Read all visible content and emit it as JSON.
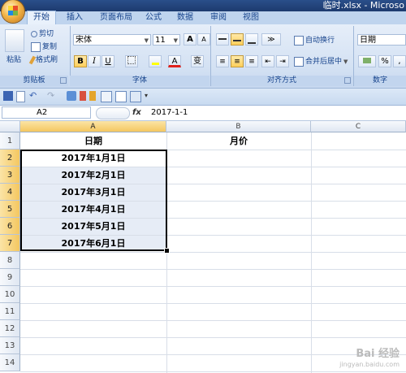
{
  "window": {
    "title": "临时.xlsx - Microso"
  },
  "tabs": [
    {
      "label": "开始",
      "active": true
    },
    {
      "label": "插入"
    },
    {
      "label": "页面布局"
    },
    {
      "label": "公式"
    },
    {
      "label": "数据"
    },
    {
      "label": "审阅"
    },
    {
      "label": "视图"
    }
  ],
  "ribbon": {
    "clipboard": {
      "paste": "粘贴",
      "cut": "剪切",
      "copy": "复制",
      "format_painter": "格式刷",
      "label": "剪贴板"
    },
    "font": {
      "name": "宋体",
      "size": "11",
      "bold": "B",
      "italic": "I",
      "underline": "U",
      "grow": "A",
      "shrink": "A",
      "font_color": "A",
      "phonetic": "变",
      "label": "字体"
    },
    "alignment": {
      "wrap": "自动换行",
      "merge": "合并后居中",
      "label": "对齐方式"
    },
    "number": {
      "format": "日期",
      "percent": "%",
      "comma": ",",
      "label": "数字"
    }
  },
  "formula_bar": {
    "name_box": "A2",
    "fx": "fx",
    "content": "2017-1-1"
  },
  "columns": [
    "A",
    "B",
    "C"
  ],
  "rows": [
    "1",
    "2",
    "3",
    "4",
    "5",
    "6",
    "7",
    "8",
    "9",
    "10",
    "11",
    "12",
    "13",
    "14"
  ],
  "cells": {
    "A1": "日期",
    "B1": "月价",
    "A2": "2017年1月1日",
    "A3": "2017年2月1日",
    "A4": "2017年3月1日",
    "A5": "2017年4月1日",
    "A6": "2017年5月1日",
    "A7": "2017年6月1日"
  },
  "watermark": {
    "main": "Bai 经验",
    "sub": "jingyan.baidu.com"
  },
  "colors": {
    "selection": "#000000",
    "header_selected": "#f4c760",
    "range_fill": "#e6ecf6"
  }
}
